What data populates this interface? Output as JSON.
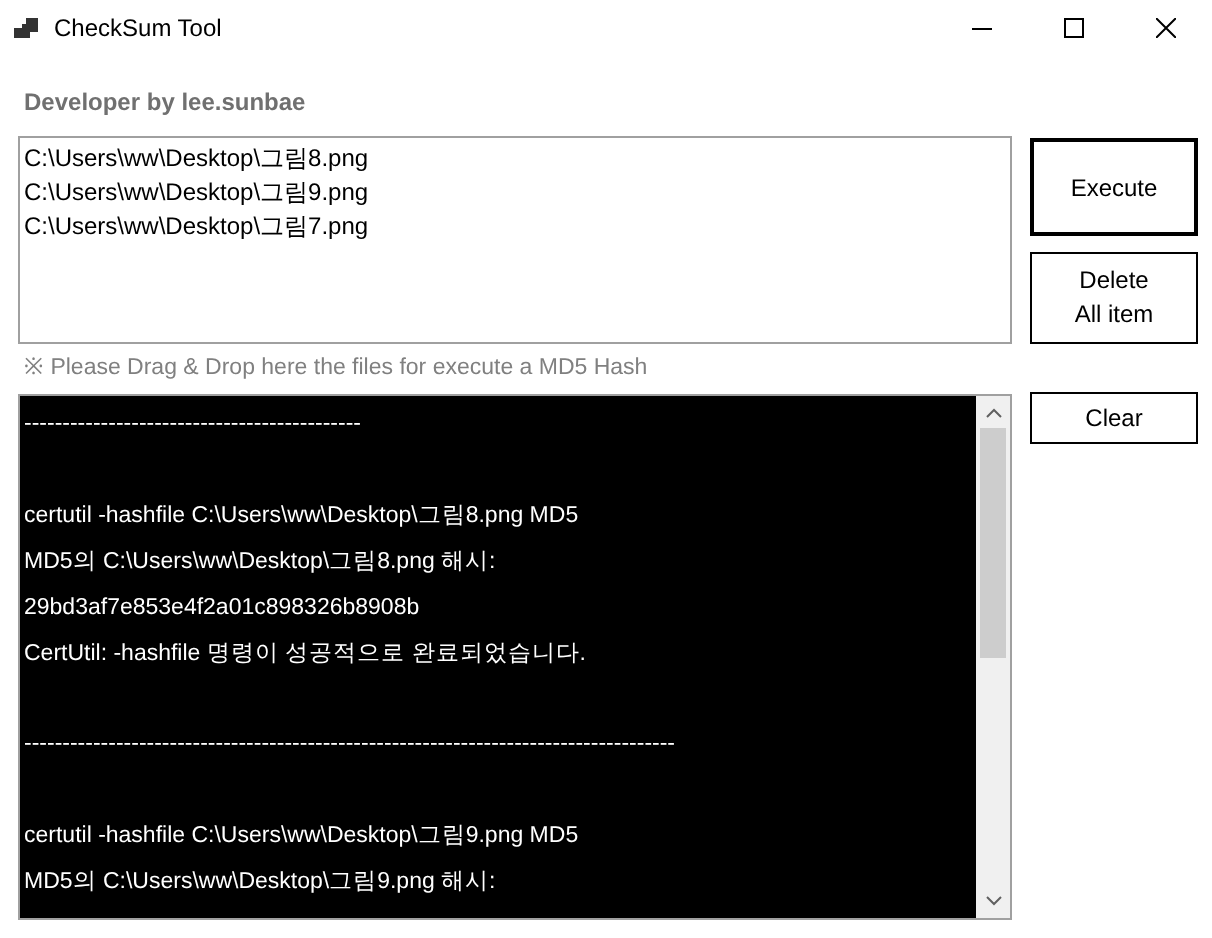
{
  "window": {
    "title": "CheckSum Tool"
  },
  "developer_label": "Developer by lee.sunbae",
  "file_list": [
    "C:\\Users\\ww\\Desktop\\그림8.png",
    "C:\\Users\\ww\\Desktop\\그림9.png",
    "C:\\Users\\ww\\Desktop\\그림7.png"
  ],
  "buttons": {
    "execute": "Execute",
    "delete_all": [
      "Delete",
      "All item"
    ],
    "clear": "Clear"
  },
  "hint": "※ Please Drag & Drop here the files for execute a MD5 Hash",
  "console_lines": [
    {
      "kind": "text",
      "text": "--------------------------------------------"
    },
    {
      "kind": "blank"
    },
    {
      "kind": "text",
      "text": "certutil -hashfile C:\\Users\\ww\\Desktop\\그림8.png MD5"
    },
    {
      "kind": "text",
      "text": "MD5의 C:\\Users\\ww\\Desktop\\그림8.png 해시:"
    },
    {
      "kind": "text",
      "text": "29bd3af7e853e4f2a01c898326b8908b"
    },
    {
      "kind": "text",
      "text": "CertUtil: -hashfile 명령이 성공적으로 완료되었습니다."
    },
    {
      "kind": "blank"
    },
    {
      "kind": "text",
      "text": "-------------------------------------------------------------------------------------"
    },
    {
      "kind": "blank"
    },
    {
      "kind": "text",
      "text": "certutil -hashfile C:\\Users\\ww\\Desktop\\그림9.png MD5"
    },
    {
      "kind": "text",
      "text": "MD5의 C:\\Users\\ww\\Desktop\\그림9.png 해시:"
    }
  ]
}
